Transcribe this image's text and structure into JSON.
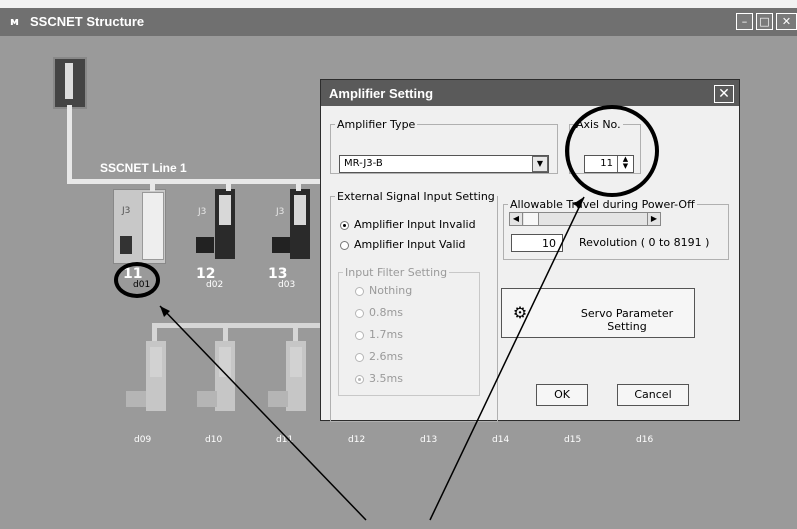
{
  "window": {
    "title": "SSCNET Structure",
    "icon": "app-icon",
    "buttons": [
      "minimize",
      "maximize",
      "close"
    ]
  },
  "diagram": {
    "line_label": "SSCNET Line 1",
    "top_row": [
      {
        "axis": "11",
        "name": "d01",
        "model": "J3"
      },
      {
        "axis": "12",
        "name": "d02",
        "model": "J3"
      },
      {
        "axis": "13",
        "name": "d03",
        "model": "J3"
      }
    ],
    "bottom_labels": [
      "d09",
      "d10",
      "d11",
      "d12",
      "d13",
      "d14",
      "d15",
      "d16"
    ]
  },
  "dialog": {
    "title": "Amplifier Setting",
    "amplifier_type": {
      "legend": "Amplifier Type",
      "value": "MR-J3-B"
    },
    "axis_no": {
      "legend": "Axis No.",
      "value": "11"
    },
    "external_signal": {
      "legend": "External Signal Input Setting",
      "options": [
        "Amplifier Input Invalid",
        "Amplifier Input Valid"
      ],
      "selected_index": 0
    },
    "input_filter": {
      "legend": "Input Filter Setting",
      "options": [
        "Nothing",
        "0.8ms",
        "1.7ms",
        "2.6ms",
        "3.5ms"
      ],
      "selected_index": 4,
      "disabled": true
    },
    "power_off": {
      "legend": "Allowable Travel during Power-Off",
      "value": "10",
      "range_label": "Revolution ( 0 to 8191 )"
    },
    "servo_button": "Servo Parameter Setting",
    "ok_button": "OK",
    "cancel_button": "Cancel"
  }
}
